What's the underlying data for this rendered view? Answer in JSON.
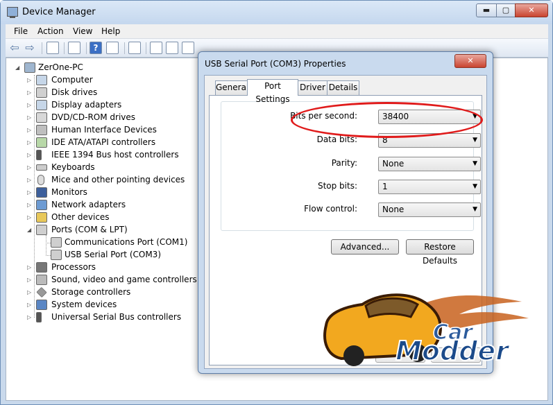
{
  "window": {
    "title": "Device Manager",
    "min_glyph": "▬",
    "max_glyph": "▢",
    "close_glyph": "✕"
  },
  "menu": [
    "File",
    "Action",
    "View",
    "Help"
  ],
  "toolbar": {
    "back_glyph": "⇦",
    "forward_glyph": "⇨",
    "help_glyph": "?"
  },
  "tree": {
    "root": "ZerOne-PC",
    "categories": [
      "Computer",
      "Disk drives",
      "Display adapters",
      "DVD/CD-ROM drives",
      "Human Interface Devices",
      "IDE ATA/ATAPI controllers",
      "IEEE 1394 Bus host controllers",
      "Keyboards",
      "Mice and other pointing devices",
      "Monitors",
      "Network adapters",
      "Other devices",
      "Ports (COM & LPT)",
      "Communications Port (COM1)",
      "USB Serial Port (COM3)",
      "Processors",
      "Sound, video and game controllers",
      "Storage controllers",
      "System devices",
      "Universal Serial Bus controllers"
    ]
  },
  "dialog": {
    "title": "USB Serial Port (COM3) Properties",
    "close_glyph": "✕",
    "tabs": [
      "General",
      "Port Settings",
      "Driver",
      "Details"
    ],
    "active_tab": "Port Settings",
    "fields": [
      {
        "label": "Bits per second:",
        "value": "38400"
      },
      {
        "label": "Data bits:",
        "value": "8"
      },
      {
        "label": "Parity:",
        "value": "None"
      },
      {
        "label": "Stop bits:",
        "value": "1"
      },
      {
        "label": "Flow control:",
        "value": "None"
      }
    ],
    "combo_arrow": "▼",
    "advanced_label": "Advanced...",
    "restore_label": "Restore Defaults"
  },
  "logo": {
    "line1": "Car",
    "line2": "Modder"
  },
  "colors": {
    "highlight_ellipse": "#e01b1b",
    "title_bar": "#c4d7ee",
    "close_button": "#c94430"
  }
}
